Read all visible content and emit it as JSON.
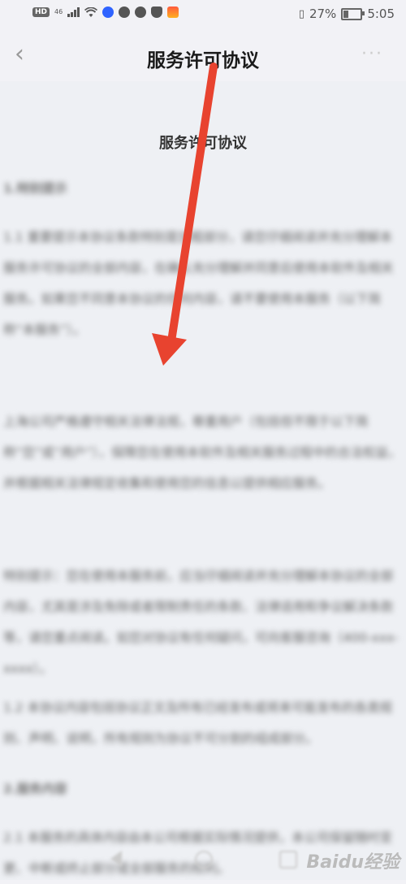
{
  "status": {
    "network_badge": "HD",
    "network_type": "46",
    "battery_percent": "27%",
    "time": "5:05"
  },
  "nav": {
    "back_glyph": "‹",
    "title": "服务许可协议",
    "more_glyph": "···"
  },
  "document": {
    "title": "服务许可协议",
    "sections": [
      {
        "heading": "1.特别提示"
      },
      {
        "paragraph": "1.1 重要提示本协议条款特别是加粗部分，请您仔细阅读并充分理解本服务许可协议的全部内容，在确认充分理解并同意后使用本软件及相关服务。如果您不同意本协议的任何内容，请不要使用本服务（以下简称“本服务”）。"
      },
      {
        "paragraph": "上海公司严格遵守相关法律法规，尊重用户（包括但不限于以下简称“您”或“用户”），保障您在使用本软件及相关服务过程中的合法权益，并根据相关法律规定收集和使用您的信息以提供相应服务。"
      },
      {
        "paragraph": "特别提示：您在使用本服务前，应当仔细阅读并充分理解本协议的全部内容，尤其是涉及免除或者限制责任的条款、法律适用和争议解决条款等，请您重点阅读。如您对协议有任何疑问，可向客服咨询（400-xxx-xxxx）。"
      },
      {
        "paragraph": "1.2 本协议内容包括协议正文及所有已经发布或将来可能发布的各类规则、声明、说明，所有规则为协议不可分割的组成部分。"
      },
      {
        "heading": "2.服务内容"
      },
      {
        "paragraph": "2.1 本服务的具体内容由本公司根据实际情况提供，本公司保留随时变更、中断或终止部分或全部服务的权利。"
      }
    ]
  },
  "watermark": "Baidu经验"
}
